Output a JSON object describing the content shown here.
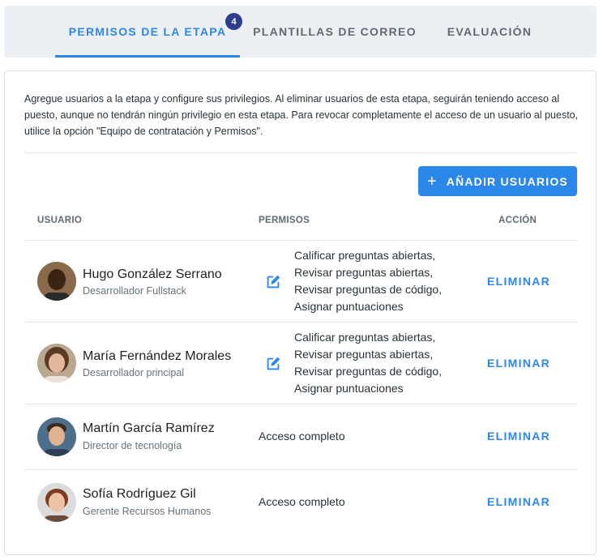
{
  "tabs": [
    {
      "label": "PERMISOS DE LA ETAPA",
      "badge": "4",
      "active": true
    },
    {
      "label": "PLANTILLAS DE CORREO"
    },
    {
      "label": "EVALUACIÓN"
    }
  ],
  "intro": "Agregue usuarios a la etapa y configure sus privilegios. Al eliminar usuarios de esta etapa, seguirán teniendo acceso al puesto, aunque no tendrán ningún privilegio en esta etapa. Para revocar completamente el acceso de un usuario al puesto, utilice la opción \"Equipo de contratación y Permisos\".",
  "add_button": {
    "icon": "plus-icon",
    "label": "AÑADIR USUARIOS"
  },
  "table": {
    "headers": {
      "user": "USUARIO",
      "permissions": "PERMISOS",
      "action": "ACCIÓN"
    },
    "rows": [
      {
        "name": "Hugo González Serrano",
        "role": "Desarrollador Fullstack",
        "permissions": [
          "Calificar preguntas abiertas,",
          "Revisar preguntas abiertas,",
          "Revisar preguntas de código,",
          "Asignar puntuaciones"
        ],
        "action": "ELIMINAR"
      },
      {
        "name": "María Fernández Morales",
        "role": "Desarrollador principal",
        "permissions": [
          "Calificar preguntas abiertas,",
          "Revisar preguntas abiertas,",
          "Revisar preguntas de código,",
          "Asignar puntuaciones"
        ],
        "action": "ELIMINAR"
      },
      {
        "name": "Martín García Ramírez",
        "role": "Director de tecnología",
        "permissions_text": "Acceso completo",
        "action": "ELIMINAR"
      },
      {
        "name": "Sofía Rodríguez Gil",
        "role": "Gerente Recursos Humanos",
        "permissions_text": "Acceso completo",
        "action": "ELIMINAR"
      }
    ]
  },
  "colors": {
    "accent": "#2c87ea",
    "badge": "#2f3e88"
  }
}
